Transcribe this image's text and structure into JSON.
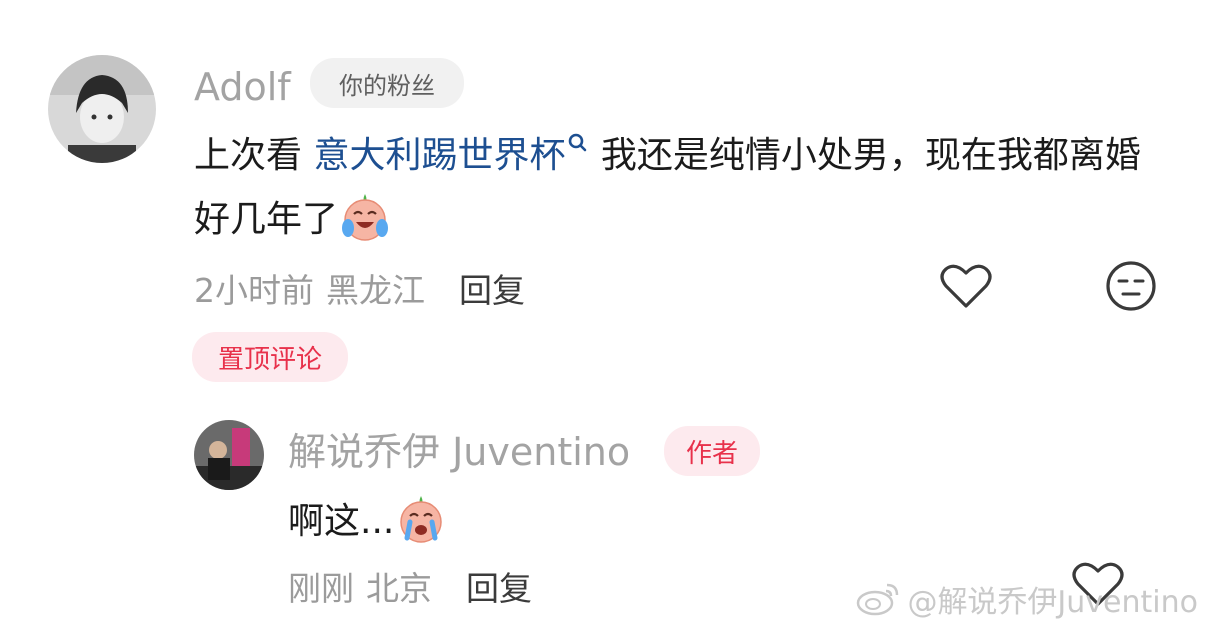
{
  "comment": {
    "username": "Adolf",
    "fan_badge": "你的粉丝",
    "text_before": "上次看 ",
    "topic_link": "意大利踢世界杯",
    "text_after": " 我还是纯情小处男，现在我都离婚好几年了",
    "time": "2小时前",
    "location": "黑龙江",
    "reply_label": "回复",
    "pinned_label": "置顶评论"
  },
  "reply": {
    "username": "解说乔伊 Juventino",
    "author_badge": "作者",
    "text": "啊这...",
    "time": "刚刚",
    "location": "北京",
    "reply_label": "回复"
  },
  "watermark": "@解说乔伊Juventino",
  "colors": {
    "link": "#1d4f91",
    "accent_red": "#e8314b",
    "meta_gray": "#9b9b9b"
  }
}
